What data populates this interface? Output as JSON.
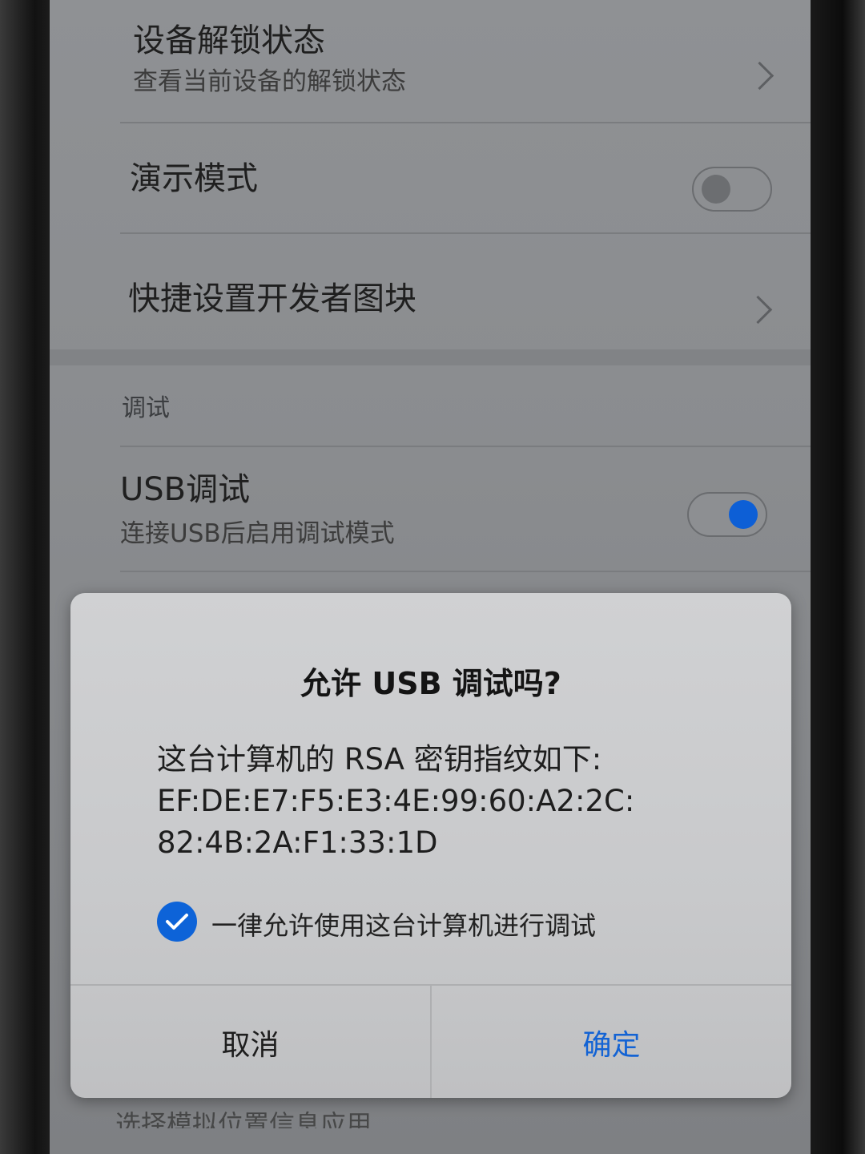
{
  "settings": {
    "unlock_status": {
      "title": "设备解锁状态",
      "subtitle": "查看当前设备的解锁状态",
      "icon": "chevron-right-icon"
    },
    "demo_mode": {
      "title": "演示模式",
      "toggle": "off"
    },
    "quick_tiles": {
      "title": "快捷设置开发者图块",
      "icon": "chevron-right-icon"
    },
    "debug_section": {
      "label": "调试"
    },
    "usb_debug": {
      "title": "USB调试",
      "subtitle": "连接USB后启用调试模式",
      "toggle": "on"
    },
    "bottom_peek": "选择模拟位置信息应用"
  },
  "dialog": {
    "title": "允许 USB 调试吗?",
    "message_lines": [
      "这台计算机的 RSA 密钥指纹如下:",
      "EF:DE:E7:F5:E3:4E:99:60:A2:2C:",
      "82:4B:2A:F1:33:1D"
    ],
    "checkbox": {
      "label": "一律允许使用这台计算机进行调试",
      "checked": true,
      "icon": "checkmark-icon"
    },
    "cancel_label": "取消",
    "ok_label": "确定"
  },
  "colors": {
    "accent": "#0d63d8",
    "ok_text": "#1363d4"
  }
}
